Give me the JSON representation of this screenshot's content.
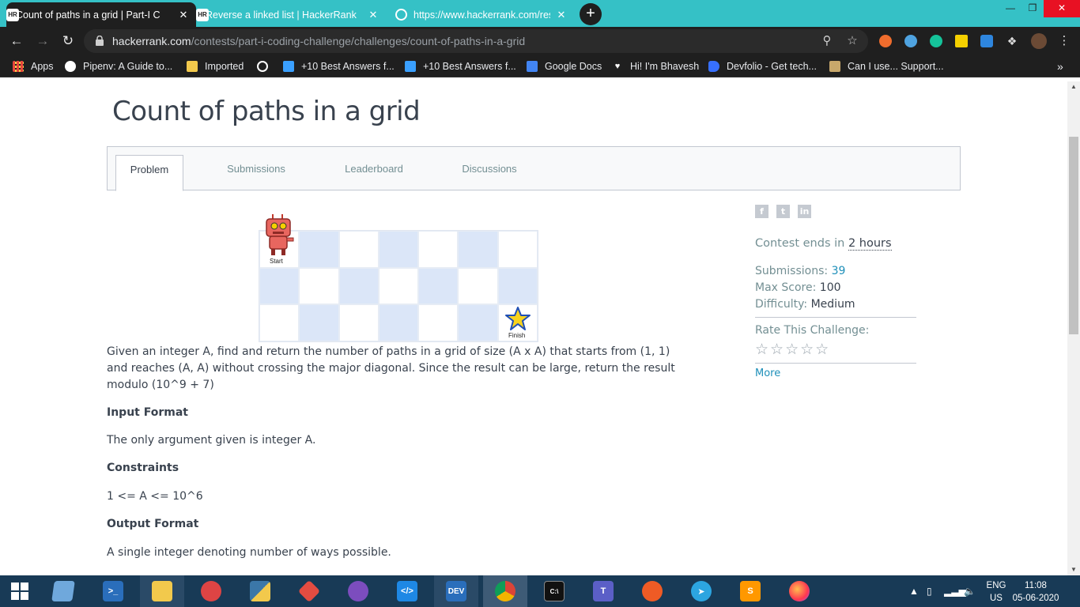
{
  "browser": {
    "tabs": [
      {
        "label": "Count of paths in a grid | Part-I C",
        "favicon": "hackerrank-icon",
        "active": true
      },
      {
        "label": "Reverse a linked list | HackerRank",
        "favicon": "hackerrank-icon",
        "active": false
      },
      {
        "label": "https://www.hackerrank.com/rest",
        "favicon": "globe-icon",
        "active": false
      }
    ],
    "new_tab_symbol": "+",
    "url_domain": "hackerrank.com",
    "url_path": "/contests/part-i-coding-challenge/challenges/count-of-paths-in-a-grid"
  },
  "bookmarks": [
    {
      "label": "Apps",
      "icon": "apps-grid-icon",
      "color": "#e8453c"
    },
    {
      "label": "Pipenv: A Guide to...",
      "icon": "python-icon",
      "color": "#ffffff"
    },
    {
      "label": "Imported",
      "icon": "folder-icon",
      "color": "#f2c94c"
    },
    {
      "label": "",
      "icon": "globe-icon",
      "color": "#ffffff"
    },
    {
      "label": "+10 Best Answers f...",
      "icon": "n-logo-icon",
      "color": "#3aa0ff"
    },
    {
      "label": "+10 Best Answers f...",
      "icon": "n-logo-icon",
      "color": "#3aa0ff"
    },
    {
      "label": "Google Docs",
      "icon": "docs-icon",
      "color": "#4285f4"
    },
    {
      "label": "Hi! I'm Bhavesh",
      "icon": "heart-icon",
      "color": "#ffffff"
    },
    {
      "label": "Devfolio - Get tech...",
      "icon": "devfolio-icon",
      "color": "#3770ff"
    },
    {
      "label": "Can I use... Support...",
      "icon": "caniuse-icon",
      "color": "#c8a86b"
    }
  ],
  "bookmarks_overflow": "»",
  "page": {
    "title": "Count of paths in a grid",
    "tabs": [
      "Problem",
      "Submissions",
      "Leaderboard",
      "Discussions"
    ],
    "figure": {
      "start_label": "Start",
      "finish_label": "Finish"
    },
    "description": "Given an integer A, find and return the number of paths in a grid of size (A x A) that starts from (1, 1) and reaches (A, A) without crossing the major diagonal. Since the result can be large, return the result modulo (10^9 + 7)",
    "input_format_heading": "Input Format",
    "input_format_text": "The only argument given is integer A.",
    "constraints_heading": "Constraints",
    "constraints_text": "1 <= A <= 10^6",
    "output_format_heading": "Output Format",
    "output_format_text": "A single integer denoting number of ways possible."
  },
  "sidebar": {
    "social": [
      "f",
      "t",
      "in"
    ],
    "contest_ends_label": "Contest ends in",
    "contest_ends_value": "2 hours",
    "submissions_label": "Submissions:",
    "submissions_value": "39",
    "max_score_label": "Max Score:",
    "max_score_value": "100",
    "difficulty_label": "Difficulty:",
    "difficulty_value": "Medium",
    "rate_label": "Rate This Challenge:",
    "rating": "☆☆☆☆☆",
    "more_link": "More"
  },
  "taskbar": {
    "lang_line1": "ENG",
    "lang_line2": "US",
    "time": "11:08",
    "date": "05-06-2020"
  },
  "colors": {
    "titlebar": "#35c1c6",
    "chrome_dark": "#1f1f1f",
    "taskbar": "#183a56",
    "grid_dark": "#dbe6f8",
    "link": "#1d8fb9"
  }
}
